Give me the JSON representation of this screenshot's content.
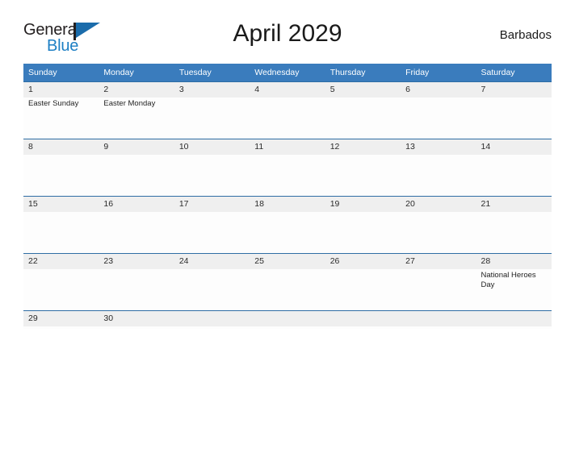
{
  "brand": {
    "name_part1": "General",
    "name_part2": "Blue",
    "flag_icon": "flag-triangle-icon"
  },
  "header": {
    "title": "April 2029",
    "country": "Barbados"
  },
  "colors": {
    "header_blue": "#3a7cbd",
    "row_border_blue": "#2e6da4",
    "daynum_band": "#efefef",
    "brand_blue": "#1d7fc4",
    "text_dark": "#1a1a1a"
  },
  "calendar": {
    "weekday_headers": [
      "Sunday",
      "Monday",
      "Tuesday",
      "Wednesday",
      "Thursday",
      "Friday",
      "Saturday"
    ],
    "weeks": [
      [
        {
          "day": "1",
          "events": [
            "Easter Sunday"
          ]
        },
        {
          "day": "2",
          "events": [
            "Easter Monday"
          ]
        },
        {
          "day": "3",
          "events": []
        },
        {
          "day": "4",
          "events": []
        },
        {
          "day": "5",
          "events": []
        },
        {
          "day": "6",
          "events": []
        },
        {
          "day": "7",
          "events": []
        }
      ],
      [
        {
          "day": "8",
          "events": []
        },
        {
          "day": "9",
          "events": []
        },
        {
          "day": "10",
          "events": []
        },
        {
          "day": "11",
          "events": []
        },
        {
          "day": "12",
          "events": []
        },
        {
          "day": "13",
          "events": []
        },
        {
          "day": "14",
          "events": []
        }
      ],
      [
        {
          "day": "15",
          "events": []
        },
        {
          "day": "16",
          "events": []
        },
        {
          "day": "17",
          "events": []
        },
        {
          "day": "18",
          "events": []
        },
        {
          "day": "19",
          "events": []
        },
        {
          "day": "20",
          "events": []
        },
        {
          "day": "21",
          "events": []
        }
      ],
      [
        {
          "day": "22",
          "events": []
        },
        {
          "day": "23",
          "events": []
        },
        {
          "day": "24",
          "events": []
        },
        {
          "day": "25",
          "events": []
        },
        {
          "day": "26",
          "events": []
        },
        {
          "day": "27",
          "events": []
        },
        {
          "day": "28",
          "events": [
            "National Heroes Day"
          ]
        }
      ],
      [
        {
          "day": "29",
          "events": []
        },
        {
          "day": "30",
          "events": []
        },
        {
          "day": "",
          "events": []
        },
        {
          "day": "",
          "events": []
        },
        {
          "day": "",
          "events": []
        },
        {
          "day": "",
          "events": []
        },
        {
          "day": "",
          "events": []
        }
      ]
    ]
  }
}
